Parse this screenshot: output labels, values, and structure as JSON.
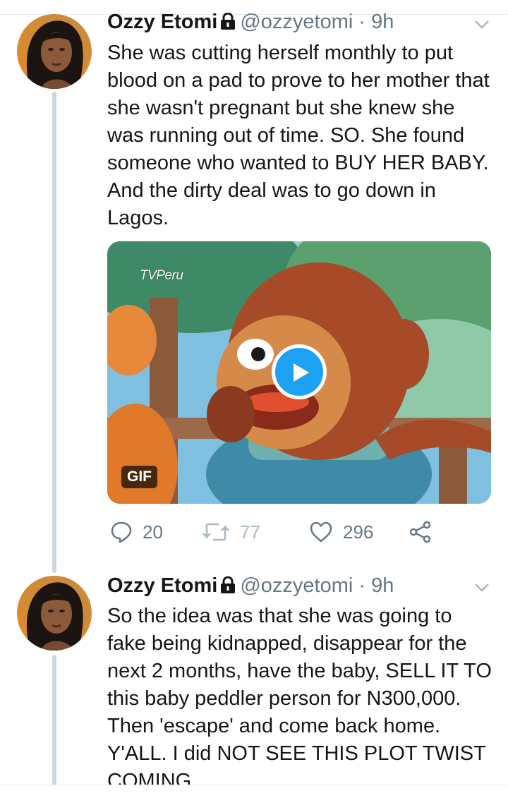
{
  "tweets": [
    {
      "author_name": "Ozzy Etomi",
      "handle": "@ozzyetomi",
      "separator": "·",
      "time": "9h",
      "text": "She was cutting herself monthly to put blood on a pad to prove to her mother that she wasn't pregnant but she knew she was running out of time. SO. She found someone who wanted to BUY HER BABY. And the dirty deal was to go down in Lagos.",
      "media": {
        "watermark": "TVPeru",
        "badge": "GIF"
      },
      "actions": {
        "replies": "20",
        "retweets": "77",
        "likes": "296"
      }
    },
    {
      "author_name": "Ozzy Etomi",
      "handle": "@ozzyetomi",
      "separator": "·",
      "time": "9h",
      "text": "So the idea was that she was going to fake being kidnapped, disappear for the next 2 months, have the baby, SELL IT TO this baby peddler person for N300,000. Then 'escape' and come back home. Y'ALL. I did NOT SEE THIS PLOT TWIST COMING"
    }
  ],
  "icons": {
    "lock": "lock-icon",
    "chevron": "chevron-down-icon",
    "reply": "reply-icon",
    "retweet": "retweet-icon",
    "like": "heart-icon",
    "share": "share-icon",
    "play": "play-icon"
  },
  "colors": {
    "accent": "#1da1f2",
    "secondary_text": "#657786",
    "thread_line": "#ccd6dd"
  }
}
